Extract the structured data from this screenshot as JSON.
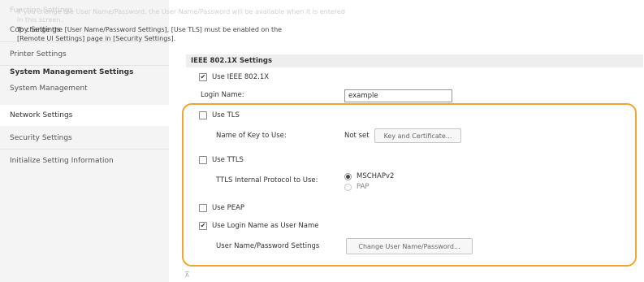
{
  "sidebar": {
    "items": [
      {
        "label": "Function Settings"
      },
      {
        "label": "Copy Settings"
      },
      {
        "label": "Printer Settings"
      },
      {
        "label": "System Management Settings"
      },
      {
        "label": "System Management"
      },
      {
        "label": "Network Settings"
      },
      {
        "label": "Security Settings"
      },
      {
        "label": "Initialize Setting Information"
      }
    ]
  },
  "intro": {
    "line1": "If you change the User Name/Password, the User Name/Password will be available when it is entered",
    "line2": "in this screen.",
    "line3": "To change the [User Name/Password Settings], [Use TLS] must be enabled on the",
    "line4": "[Remote UI Settings] page in [Security Settings]."
  },
  "section": {
    "title": "IEEE 802.1X Settings"
  },
  "form": {
    "use_ieee": {
      "label": "Use IEEE 802.1X",
      "checked": true
    },
    "login_name": {
      "label": "Login Name:",
      "value": "example"
    },
    "use_tls": {
      "label": "Use TLS",
      "checked": false
    },
    "key_to_use": {
      "label": "Name of Key to Use:",
      "value": "Not set",
      "button": "Key and Certificate..."
    },
    "use_ttls": {
      "label": "Use TTLS",
      "checked": false
    },
    "ttls_protocol": {
      "label": "TTLS Internal Protocol to Use:",
      "options": [
        "MSCHAPv2",
        "PAP"
      ],
      "selected": "MSCHAPv2"
    },
    "use_peap": {
      "label": "Use PEAP",
      "checked": false
    },
    "use_login_name": {
      "label": "Use Login Name as User Name",
      "checked": true
    },
    "user_pass": {
      "label": "User Name/Password Settings",
      "button": "Change User Name/Password..."
    }
  },
  "footer": {
    "mark": "⊼"
  },
  "colors": {
    "highlight": "#f2a631",
    "sidebar_bg": "#f4f4f4",
    "section_bg": "#eeeeee"
  }
}
